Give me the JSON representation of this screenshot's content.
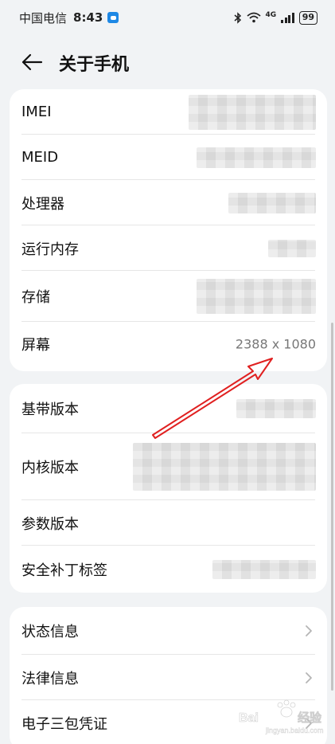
{
  "status_bar": {
    "carrier": "中国电信",
    "time": "8:43",
    "network": "4G",
    "battery": "99"
  },
  "header": {
    "title": "关于手机"
  },
  "card1": {
    "rows": [
      {
        "label": "IMEI",
        "value": ""
      },
      {
        "label": "MEID",
        "value": ""
      },
      {
        "label": "处理器",
        "value": ""
      },
      {
        "label": "运行内存",
        "value": ""
      },
      {
        "label": "存储",
        "value": ""
      },
      {
        "label": "屏幕",
        "value": "2388 x 1080"
      }
    ]
  },
  "card2": {
    "rows": [
      {
        "label": "基带版本"
      },
      {
        "label": "内核版本"
      },
      {
        "label": "参数版本"
      },
      {
        "label": "安全补丁标签"
      }
    ]
  },
  "card3": {
    "rows": [
      {
        "label": "状态信息"
      },
      {
        "label": "法律信息"
      },
      {
        "label": "电子三包凭证"
      }
    ]
  },
  "colors": {
    "annotation_arrow": "#e02020",
    "page_background": "#f1f3f5"
  }
}
